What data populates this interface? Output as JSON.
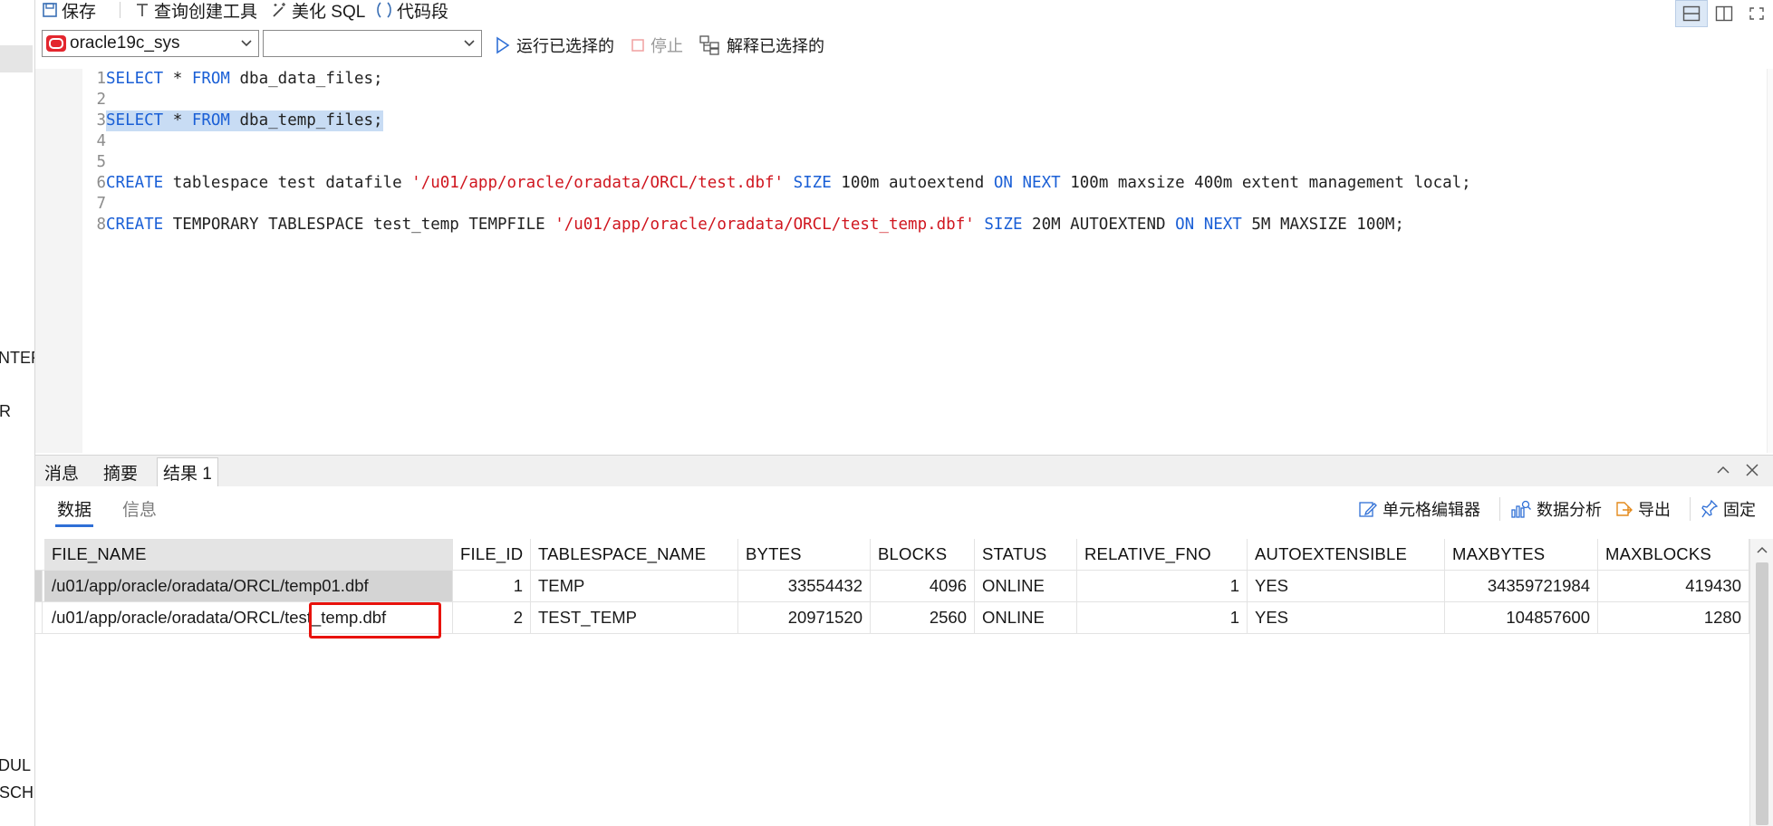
{
  "toolbar": {
    "save_label": "保存",
    "query_builder_label": "查询创建工具",
    "beautify_label": "美化 SQL",
    "snippet_label": "代码段"
  },
  "connection": {
    "selected": "oracle19c_sys",
    "schema_selected": ""
  },
  "actions": {
    "run_selected": "运行已选择的",
    "stop": "停止",
    "explain_selected": "解释已选择的"
  },
  "left_strip": {
    "texts": [
      "NTER",
      "R",
      "DUL",
      "SCH"
    ]
  },
  "editor": {
    "lines": [
      {
        "n": "1",
        "text": "SELECT * FROM dba_data_files;"
      },
      {
        "n": "2",
        "text": ""
      },
      {
        "n": "3",
        "text": "SELECT * FROM dba_temp_files;",
        "selected": true
      },
      {
        "n": "4",
        "text": ""
      },
      {
        "n": "5",
        "text": ""
      },
      {
        "n": "6",
        "text": "CREATE tablespace test datafile '/u01/app/oracle/oradata/ORCL/test.dbf' SIZE 100m autoextend ON NEXT 100m maxsize 400m extent management local;"
      },
      {
        "n": "7",
        "text": ""
      },
      {
        "n": "8",
        "text": "CREATE TEMPORARY TABLESPACE test_temp TEMPFILE '/u01/app/oracle/oradata/ORCL/test_temp.dbf' SIZE 20M AUTOEXTEND ON NEXT 5M MAXSIZE 100M;"
      }
    ]
  },
  "panel": {
    "tabs": [
      "消息",
      "摘要",
      "结果 1"
    ],
    "active_tab": "结果 1",
    "subtabs": [
      "数据",
      "信息"
    ],
    "active_subtab": "数据",
    "tools": {
      "cell_editor": "单元格编辑器",
      "data_analysis": "数据分析",
      "export": "导出",
      "pin": "固定"
    }
  },
  "grid": {
    "columns": [
      "FILE_NAME",
      "FILE_ID",
      "TABLESPACE_NAME",
      "BYTES",
      "BLOCKS",
      "STATUS",
      "RELATIVE_FNO",
      "AUTOEXTENSIBLE",
      "MAXBYTES",
      "MAXBLOCKS"
    ],
    "rows": [
      [
        "/u01/app/oracle/oradata/ORCL/temp01.dbf",
        "1",
        "TEMP",
        "33554432",
        "4096",
        "ONLINE",
        "1",
        "YES",
        "34359721984",
        "419430"
      ],
      [
        "/u01/app/oracle/oradata/ORCL/test_temp.dbf",
        "2",
        "TEST_TEMP",
        "20971520",
        "2560",
        "ONLINE",
        "1",
        "YES",
        "104857600",
        "1280"
      ]
    ]
  },
  "colors": {
    "keyword": "#1a5fd6",
    "string": "#d0161f",
    "selection": "#c8dcf4",
    "highlight_box": "#e8120c",
    "accent": "#2f6fd6"
  }
}
